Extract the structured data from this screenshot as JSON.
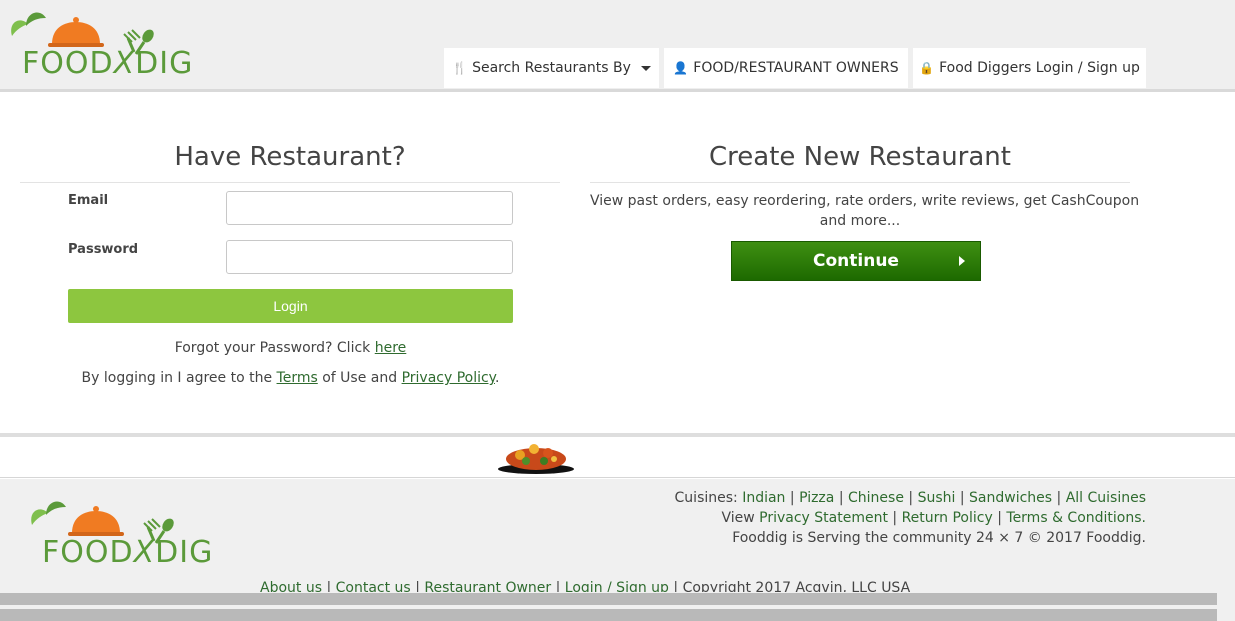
{
  "brand": {
    "logo_text_left": "FOOD",
    "logo_text_x": "X",
    "logo_text_right": "DIG"
  },
  "nav": {
    "search_label": "Search Restaurants By",
    "owners_label": "FOOD/RESTAURANT OWNERS",
    "login_label": "Food Diggers Login / Sign up",
    "icons": [
      "fork-knife-icon",
      "user-icon",
      "lock-icon",
      "chevron-down-icon"
    ]
  },
  "login_panel": {
    "title": "Have Restaurant?",
    "email_label": "Email",
    "email_value": "",
    "password_label": "Password",
    "password_value": "",
    "login_button": "Login",
    "forgot_text": "Forgot your Password? Click",
    "forgot_link": "here",
    "agree_prefix": "By logging in I agree to the",
    "terms_link": "Terms",
    "agree_middle": "of Use and",
    "privacy_link": "Privacy Policy",
    "agree_suffix": "."
  },
  "create_panel": {
    "title": "Create New Restaurant",
    "desc_line1": "View past orders, easy reordering, rate orders, write reviews, get CashCoupon",
    "desc_line2": "and more...",
    "continue_button": "Continue"
  },
  "footer": {
    "cuisines_label": "Cuisines:",
    "cuisines": [
      "Indian",
      "Pizza",
      "Chinese",
      "Sushi",
      "Sandwiches",
      "All Cuisines"
    ],
    "view_label": "View",
    "privacy": "Privacy Statement",
    "return_policy": "Return Policy",
    "terms": "Terms & Conditions.",
    "serving": "Fooddig is Serving the community 24 × 7 © 2017 Fooddig.",
    "bottom_links": [
      "About us",
      "Contact us",
      "Restaurant Owner",
      "Login / Sign up"
    ],
    "copyright": "Copyright 2017 Acqvin, LLC USA"
  },
  "colors": {
    "accent_green": "#8dc63f",
    "dark_green": "#1d6a00",
    "link_green": "#2f6b2f",
    "logo_orange": "#f07b22"
  }
}
